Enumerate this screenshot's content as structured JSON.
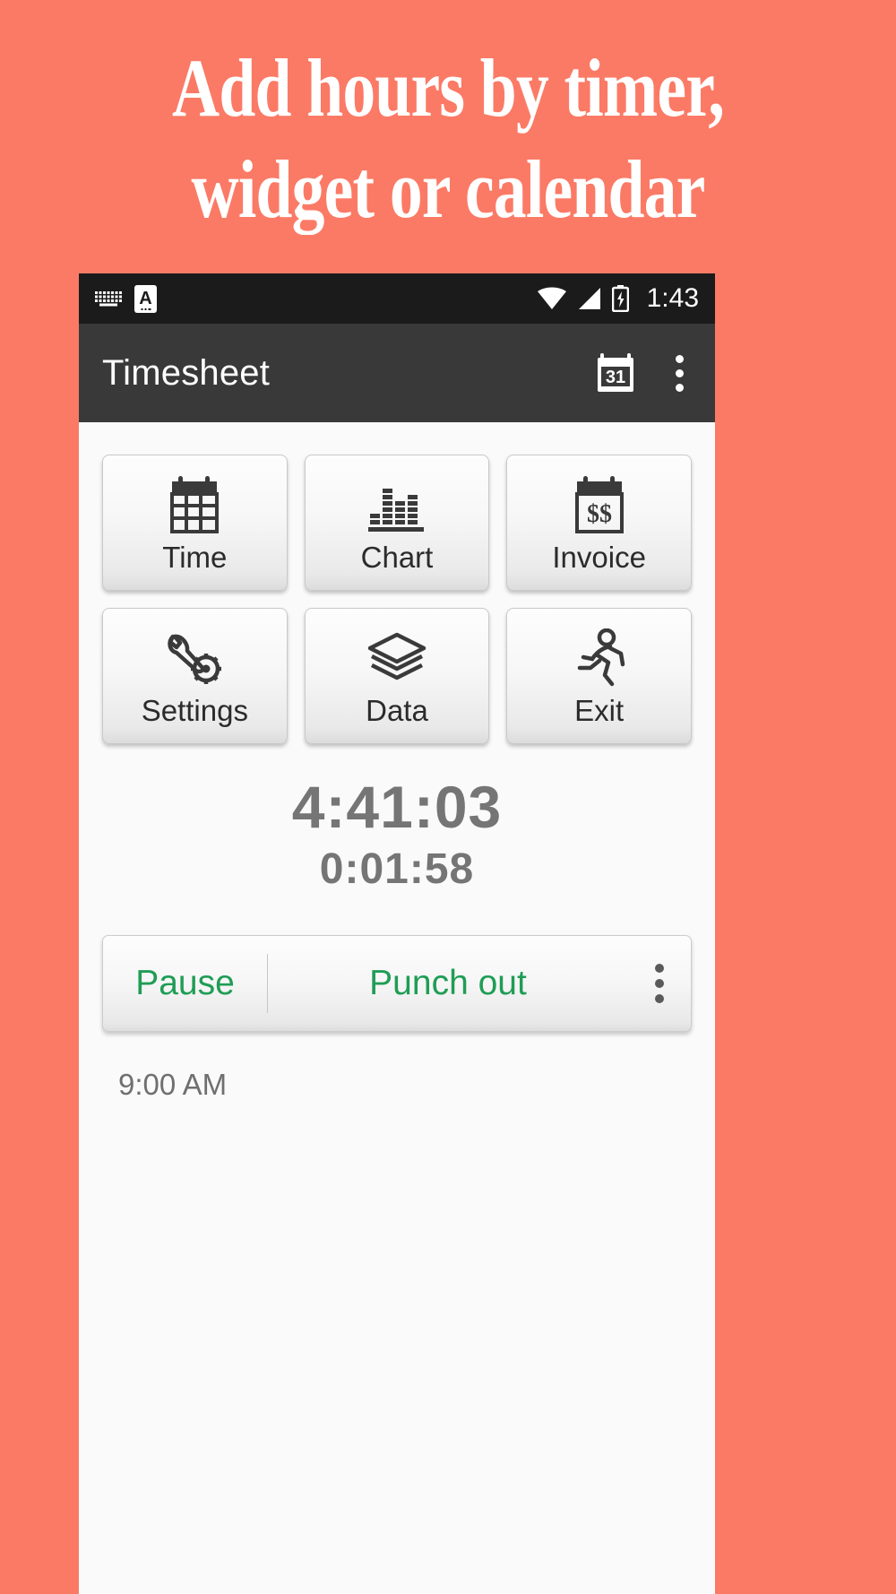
{
  "promo": {
    "line1": "Add hours by timer,",
    "line2": "widget or calendar",
    "background_color": "#fb7a66",
    "text_color": "#ffffff"
  },
  "status_bar": {
    "icons": [
      "keyboard-icon",
      "input-method-a-icon",
      "wifi-icon",
      "cellular-signal-icon",
      "battery-charging-icon"
    ],
    "time": "1:43",
    "background_color": "#1b1b1b"
  },
  "app_bar": {
    "title": "Timesheet",
    "calendar_icon_label": "31",
    "actions": [
      "calendar-icon",
      "overflow-menu-icon"
    ],
    "background_color": "#393939"
  },
  "grid_buttons": [
    {
      "label": "Time",
      "icon": "calendar-grid-icon"
    },
    {
      "label": "Chart",
      "icon": "bar-chart-icon"
    },
    {
      "label": "Invoice",
      "icon": "calendar-dollar-icon"
    },
    {
      "label": "Settings",
      "icon": "wrench-gear-icon"
    },
    {
      "label": "Data",
      "icon": "layers-icon"
    },
    {
      "label": "Exit",
      "icon": "running-person-icon"
    }
  ],
  "timer": {
    "total": "4:41:03",
    "current": "0:01:58",
    "color": "#757575"
  },
  "action_bar": {
    "pause_label": "Pause",
    "punch_label": "Punch out",
    "accent_color": "#1f9d55",
    "overflow_icon": "overflow-menu-icon"
  },
  "entry": {
    "start_time": "9:00 AM"
  }
}
